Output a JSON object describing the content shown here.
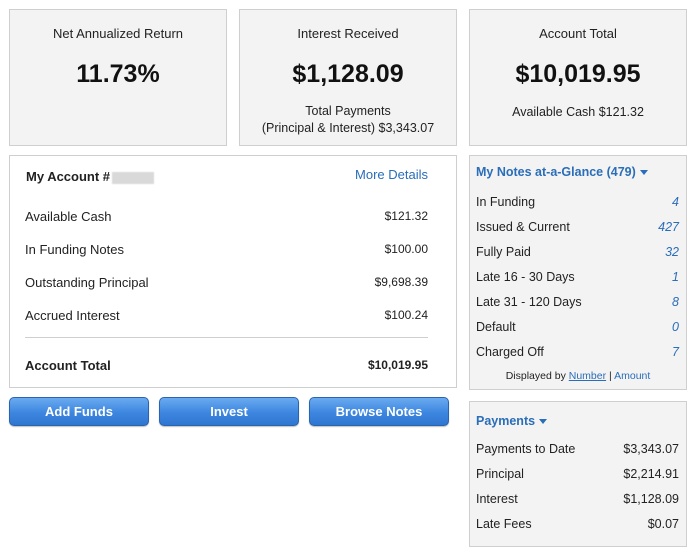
{
  "stats": {
    "net_return": {
      "label": "Net Annualized Return",
      "value": "11.73%"
    },
    "interest": {
      "label": "Interest Received",
      "value": "$1,128.09",
      "sub1": "Total Payments",
      "sub2": "(Principal & Interest) $3,343.07"
    },
    "account_total": {
      "label": "Account Total",
      "value": "$10,019.95",
      "sub": "Available Cash $121.32"
    }
  },
  "account": {
    "title": "My Account #",
    "more_details": "More Details",
    "rows": [
      {
        "label": "Available Cash",
        "value": "$121.32"
      },
      {
        "label": "In Funding Notes",
        "value": "$100.00"
      },
      {
        "label": "Outstanding Principal",
        "value": "$9,698.39"
      },
      {
        "label": "Accrued Interest",
        "value": "$100.24"
      }
    ],
    "total_label": "Account Total",
    "total_value": "$10,019.95"
  },
  "buttons": {
    "add_funds": "Add Funds",
    "invest": "Invest",
    "browse_notes": "Browse Notes"
  },
  "notes": {
    "title": "My Notes at-a-Glance (479)",
    "rows": [
      {
        "label": "In Funding",
        "value": "4"
      },
      {
        "label": "Issued & Current",
        "value": "427"
      },
      {
        "label": "Fully Paid",
        "value": "32"
      },
      {
        "label": "Late 16 - 30 Days",
        "value": "1"
      },
      {
        "label": "Late 31 - 120 Days",
        "value": "8"
      },
      {
        "label": "Default",
        "value": "0"
      },
      {
        "label": "Charged Off",
        "value": "7"
      }
    ],
    "footer_prefix": "Displayed by",
    "footer_number": "Number",
    "footer_sep": "|",
    "footer_amount": "Amount"
  },
  "payments": {
    "title": "Payments",
    "rows": [
      {
        "label": "Payments to Date",
        "value": "$3,343.07"
      },
      {
        "label": "Principal",
        "value": "$2,214.91"
      },
      {
        "label": "Interest",
        "value": "$1,128.09"
      },
      {
        "label": "Late Fees",
        "value": "$0.07"
      }
    ]
  },
  "colors": {
    "link": "#2a6db8",
    "panel_bg": "#f3f3f3",
    "border": "#cfcfcf",
    "button_blue": "#3d86e0"
  }
}
